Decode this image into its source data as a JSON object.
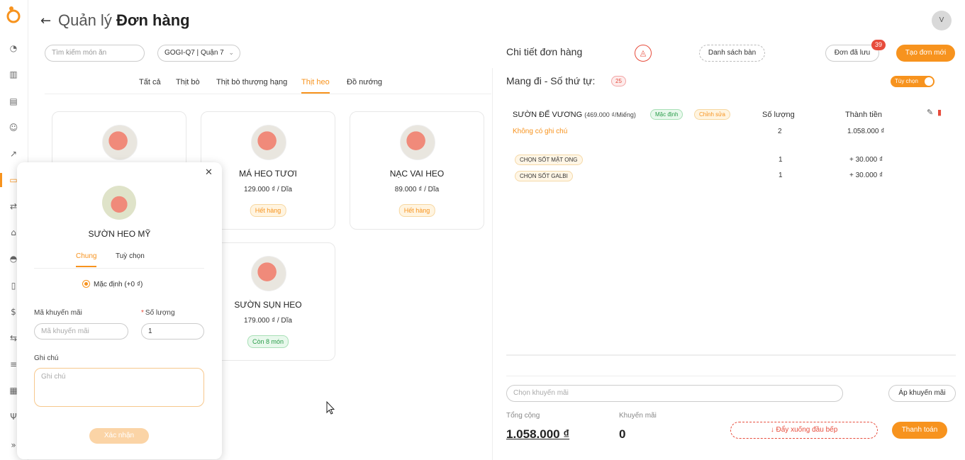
{
  "header": {
    "title_prefix": "Quản lý",
    "title_main": "Đơn hàng",
    "avatar_letter": "V"
  },
  "rail_icons": [
    "dashboard-icon",
    "chart-icon",
    "store-icon",
    "face-icon",
    "trend-icon",
    "order-icon",
    "transfer-icon",
    "house-icon",
    "gauge-icon",
    "book-icon",
    "dollar-icon",
    "swap-icon",
    "list-icon",
    "grid-icon",
    "dining-icon",
    "expand-icon"
  ],
  "left": {
    "search_placeholder": "Tìm kiếm món ăn",
    "store_select": "GOGI-Q7 | Quận 7",
    "categories": [
      "Tất cả",
      "Thịt bò",
      "Thịt bò thượng hạng",
      "Thịt heo",
      "Đồ nướng"
    ],
    "active_category": "Thịt heo",
    "products": [
      {
        "name": "MÁ HEO TƯƠI",
        "price": "129.000 ₫ / Dĩa",
        "badge": "Hết hàng"
      },
      {
        "name": "NẠC VAI HEO",
        "price": "89.000 ₫ / Dĩa",
        "badge": "Hết hàng"
      },
      {
        "name": "SƯỜN SỤN HEO",
        "price": "179.000 ₫ / Dĩa",
        "badge": "Còn 8 món"
      }
    ]
  },
  "modal": {
    "product_name": "SƯỜN HEO MỸ",
    "tab_general": "Chung",
    "tab_options": "Tuỳ chọn",
    "radio_default": "Mặc định (+0 ₫)",
    "promo_label": "Mã khuyến mãi",
    "promo_placeholder": "Mã khuyến mãi",
    "qty_label": "Số lượng",
    "qty_value": "1",
    "note_label": "Ghi chú",
    "note_placeholder": "Ghi chú",
    "confirm_label": "Xác nhận"
  },
  "right": {
    "title": "Chi tiết đơn hàng",
    "table_list_label": "Danh sách bàn",
    "saved_orders_label": "Đơn đã lưu",
    "saved_orders_count": "39",
    "new_order_label": "Tạo đơn mới",
    "takeaway_label": "Mang đi - Số thứ tự:",
    "order_number": "25",
    "toggle_label": "Tùy chọn",
    "col_qty": "Số lượng",
    "col_total": "Thành tiền",
    "item": {
      "name": "SƯỜN ĐẾ VƯƠNG",
      "unit": "(469.000 ₫/Miếng)",
      "tag_default": "Mặc định",
      "tag_edit": "Chỉnh sửa",
      "note": "Không có ghi chú",
      "qty": "2",
      "total": "1.058.000 ₫",
      "options": [
        {
          "label": "CHỌN SỐT MẬT ONG",
          "qty": "1",
          "price": "+ 30.000 ₫"
        },
        {
          "label": "CHỌN SỐT GALBI",
          "qty": "1",
          "price": "+ 30.000 ₫"
        }
      ]
    },
    "promo_placeholder": "Chọn khuyến mãi",
    "apply_promo_label": "Áp khuyến mãi",
    "total_label": "Tổng cộng",
    "total_value": "1.058.000 ₫",
    "discount_label": "Khuyến mãi",
    "discount_value": "0",
    "send_kitchen_label": "Đẩy xuống đầu bếp",
    "pay_label": "Thanh toán"
  },
  "colors": {
    "accent": "#f7931e",
    "danger": "#e74c3c",
    "success": "#2a9d4a"
  }
}
